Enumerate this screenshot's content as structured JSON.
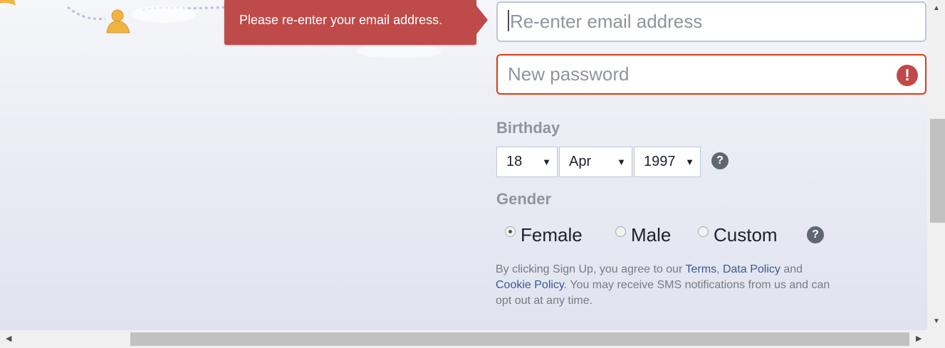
{
  "tooltip": {
    "message": "Please re-enter your email address."
  },
  "form": {
    "reenter_email": {
      "placeholder": "Re-enter email address",
      "value": ""
    },
    "new_password": {
      "placeholder": "New password",
      "value": ""
    },
    "birthday": {
      "label": "Birthday",
      "day": "18",
      "month": "Apr",
      "year": "1997"
    },
    "gender": {
      "label": "Gender",
      "options": [
        "Female",
        "Male",
        "Custom"
      ],
      "selected": "Female"
    },
    "terms": {
      "prefix": "By clicking Sign Up, you agree to our ",
      "terms_link": "Terms",
      "comma": ", ",
      "data_policy_link": "Data Policy",
      "and": " and ",
      "cookie_policy_link": "Cookie Policy",
      "suffix": ". You may receive SMS notifications from us and can opt out at any time."
    }
  },
  "icons": {
    "error": "exclamation-icon",
    "help": "question-icon"
  },
  "colors": {
    "error_red": "#be4b49",
    "link_blue": "#385898",
    "label_gray": "#90949c"
  }
}
